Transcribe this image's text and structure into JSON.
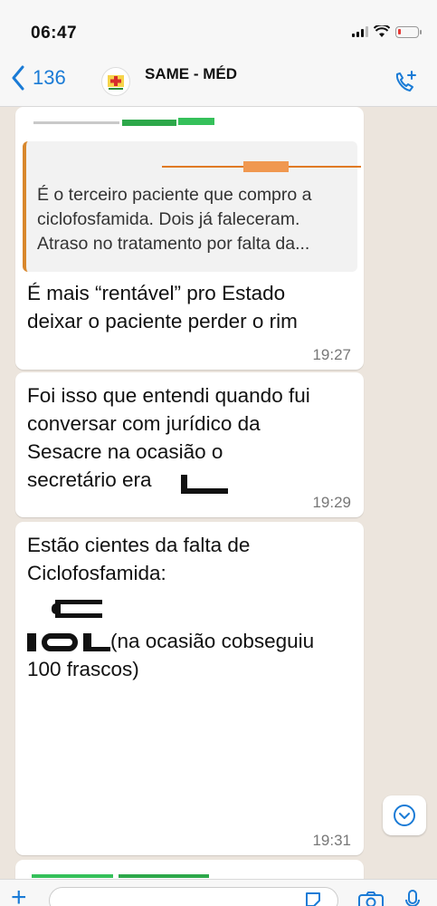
{
  "status_bar": {
    "time": "06:47"
  },
  "header": {
    "back_count": "136",
    "title": "SAME - MÉD"
  },
  "messages": [
    {
      "quote": "É o terceiro paciente que compro a ciclofosfamida. Dois já faleceram. Atraso no tratamento por falta da...",
      "quote_lines": [
        "É o terceiro paciente que compro a",
        "ciclofosfamida. Dois já faleceram.",
        "Atraso no tratamento por falta da..."
      ],
      "lines": [
        "É mais “rentável” pro Estado",
        "deixar o paciente perder o rim"
      ],
      "time": "19:27"
    },
    {
      "lines": [
        "Foi isso que entendi quando fui",
        "conversar com jurídico da",
        "Sesacre na ocasião o",
        "secretário era"
      ],
      "time": "19:29"
    },
    {
      "lines": [
        "Estão cientes da falta de",
        "Ciclofosfamida:",
        "(na ocasião cobseguiu",
        "100 frascos)"
      ],
      "time": "19:31"
    }
  ],
  "colors": {
    "accent": "#1a7bd6",
    "chat_bg": "#ece5dd",
    "bubble": "#ffffff",
    "quote_bar": "#d8872c",
    "time": "#777777"
  },
  "icons": [
    "back-chevron-icon",
    "group-avatar-icon",
    "add-call-icon",
    "scroll-down-icon",
    "plus-icon",
    "sticker-icon",
    "camera-icon",
    "mic-icon"
  ]
}
